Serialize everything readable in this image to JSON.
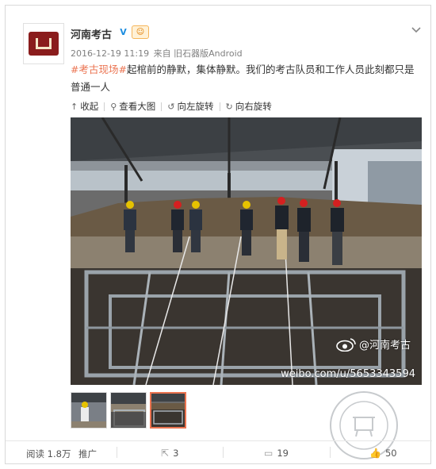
{
  "post": {
    "username": "河南考古",
    "verified_mark": "V",
    "level_badge": "☺",
    "meta": {
      "time": "2016-12-19 11:19",
      "source": "来自 旧石器版Android"
    },
    "text": {
      "hashtag": "#考古现场#",
      "body": "起棺前的静默，集体静默。我们的考古队员和工作人员此刻都只是普通一人"
    }
  },
  "toolbar": {
    "collapse_label": "收起",
    "view_large_label": "查看大图",
    "rotate_left_label": "向左旋转",
    "rotate_right_label": "向右旋转"
  },
  "watermark": {
    "handle": "@河南考古",
    "url": "weibo.com/u/5653343594"
  },
  "thumbnails": {
    "count": 3,
    "selected_index": 2
  },
  "footer": {
    "reads_label": "阅读 1.8万",
    "promote_label": "推广",
    "reposts": "3",
    "comments": "19",
    "likes": "50"
  },
  "colors": {
    "accent": "#eb7350",
    "link": "#eb7350",
    "verified": "#1d8ee0",
    "meta_text": "#808080"
  },
  "icons": {
    "collapse": "up-arrow-icon",
    "view_large": "magnify-icon",
    "rotate_left": "rotate-left-icon",
    "rotate_right": "rotate-right-icon",
    "repost": "share-icon",
    "comment": "comment-icon",
    "like": "thumb-up-icon",
    "menu": "chevron-down-icon"
  }
}
